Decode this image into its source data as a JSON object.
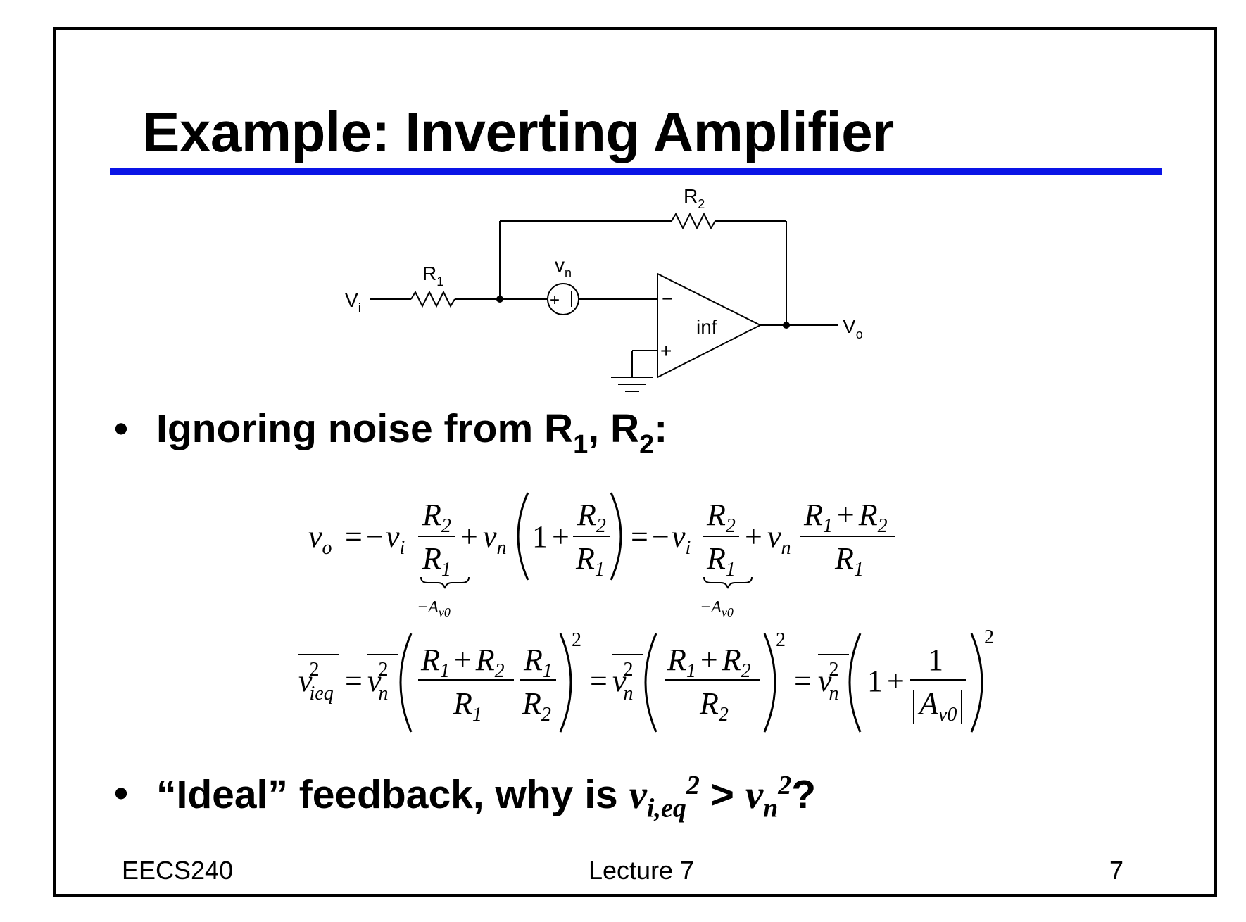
{
  "slide": {
    "title": "Example: Inverting Amplifier",
    "bullet_1": {
      "text": "Ignoring noise from R",
      "sub1": "1",
      "mid": ", R",
      "sub2": "2",
      "end": ":"
    },
    "bullet_2": {
      "text": "“Ideal” feedback, why is ",
      "v1": "v",
      "v1_sub": "i,eq",
      "v1_sup": "2",
      "gt": " > ",
      "v2": "v",
      "v2_sub": "n",
      "v2_sup": "2",
      "end": "?"
    },
    "footer": {
      "left": "EECS240",
      "center": "Lecture 7",
      "right": "7"
    },
    "accent_color": "#0a14e6"
  },
  "circuit": {
    "vi": "V",
    "vi_sub": "i",
    "r1": "R",
    "r1_sub": "1",
    "r2": "R",
    "r2_sub": "2",
    "vn": "v",
    "vn_sub": "n",
    "opamp_label": "inf",
    "vo": "V",
    "vo_sub": "o",
    "minus": "−",
    "plus": "+",
    "src_plus": "+"
  },
  "equations": {
    "eq1": {
      "vo": "v",
      "vo_sub": "o",
      "eq": "=",
      "neg": "−",
      "vi": "v",
      "vi_sub": "i",
      "R": "R",
      "s1": "1",
      "s2": "2",
      "plus": "+",
      "vn": "v",
      "vn_sub": "n",
      "one": "1",
      "brace_label": "−A",
      "brace_sub": "v0"
    },
    "eq2": {
      "v": "v",
      "sup2": "2",
      "ieq": "ieq",
      "n": "n",
      "eq": "=",
      "R": "R",
      "s1": "1",
      "s2": "2",
      "plus": "+",
      "one": "1",
      "A": "A",
      "v0": "v0",
      "outer_sup": "2"
    }
  }
}
